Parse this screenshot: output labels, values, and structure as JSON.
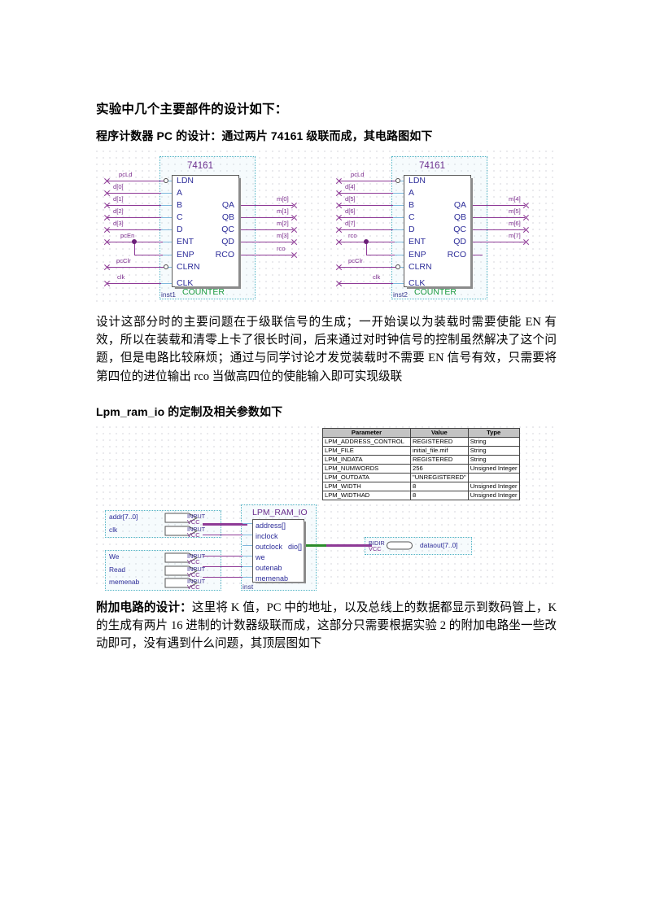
{
  "document": {
    "heading": "实验中几个主要部件的设计如下：",
    "section1_heading": "程序计数器 PC 的设计：通过两片 74161 级联而成，其电路图如下",
    "paragraph1": "设计这部分时的主要问题在于级联信号的生成；一开始误以为装载时需要使能 EN 有效，所以在装载和清零上卡了很长时间，后来通过对时钟信号的控制虽然解决了这个问题，但是电路比较麻烦；通过与同学讨论才发觉装载时不需要 EN 信号有效，只需要将第四位的进位输出 rco 当做高四位的使能输入即可实现级联",
    "section2_heading": "Lpm_ram_io 的定制及相关参数如下",
    "paragraph2_bold": "附加电路的设计：",
    "paragraph2": "这里将 K 值，PC 中的地址，以及总线上的数据都显示到数码管上，K 的生成有两片 16 进制的计数器级联而成，这部分只需要根据实验 2 的附加电路坐一些改动即可，没有遇到什么问题，其顶层图如下"
  },
  "schematic_pc": {
    "block1": {
      "chip": "74161",
      "footer": "COUNTER",
      "instance": "inst1",
      "inputs": [
        "LDN",
        "A",
        "B",
        "C",
        "D",
        "ENT",
        "ENP",
        "CLRN",
        "CLK"
      ],
      "outputs": [
        "QA",
        "QB",
        "QC",
        "QD",
        "RCO"
      ],
      "input_nets": [
        "pcLd",
        "d[0]",
        "d[1]",
        "d[2]",
        "d[3]",
        "pcEn",
        "pcClr",
        "clk"
      ],
      "output_nets": [
        "m[0]",
        "m[1]",
        "m[2]",
        "m[3]",
        "rco"
      ]
    },
    "block2": {
      "chip": "74161",
      "footer": "COUNTER",
      "instance": "inst2",
      "inputs": [
        "LDN",
        "A",
        "B",
        "C",
        "D",
        "ENT",
        "ENP",
        "CLRN",
        "CLK"
      ],
      "outputs": [
        "QA",
        "QB",
        "QC",
        "QD",
        "RCO"
      ],
      "input_nets": [
        "pcLd",
        "d[4]",
        "d[5]",
        "d[6]",
        "d[7]",
        "rco",
        "pcClr",
        "clk"
      ],
      "output_nets": [
        "m[4]",
        "m[5]",
        "m[6]",
        "m[7]"
      ]
    }
  },
  "param_table": {
    "headers": [
      "Parameter",
      "Value",
      "Type"
    ],
    "rows": [
      [
        "LPM_ADDRESS_CONTROL",
        "REGISTERED",
        "String"
      ],
      [
        "LPM_FILE",
        "initial_file.mif",
        "String"
      ],
      [
        "LPM_INDATA",
        "REGISTERED",
        "String"
      ],
      [
        "LPM_NUMWORDS",
        "256",
        "Unsigned Integer"
      ],
      [
        "LPM_OUTDATA",
        "\"UNREGISTERED\"",
        ""
      ],
      [
        "LPM_WIDTH",
        "8",
        "Unsigned Integer"
      ],
      [
        "LPM_WIDTHAD",
        "8",
        "Unsigned Integer"
      ]
    ]
  },
  "schematic_ram": {
    "chip": "LPM_RAM_IO",
    "instance": "inst",
    "inputs": [
      "address[]",
      "inclock",
      "outclock",
      "we",
      "outenab",
      "memenab"
    ],
    "outputs": [
      "dio[]"
    ],
    "input_pins": [
      {
        "label": "addr[7..0]",
        "type": "INPUT",
        "vcc": "VCC"
      },
      {
        "label": "clk",
        "type": "INPUT",
        "vcc": "VCC"
      },
      {
        "label": "We",
        "type": "INPUT",
        "vcc": "VCC"
      },
      {
        "label": "Read",
        "type": "INPUT",
        "vcc": "VCC"
      },
      {
        "label": "memenab",
        "type": "INPUT",
        "vcc": "VCC"
      }
    ],
    "output_pin": {
      "label": "dataout[7..0]",
      "type": "BIDIR",
      "vcc": "VCC"
    }
  },
  "colors": {
    "wire": "#8e3a96",
    "wire_light": "#7fb8dd",
    "port_text": "#2c2c99",
    "chip_title": "#6b2f8e",
    "footer": "#1d9b40",
    "selection": "#4fb3c4"
  }
}
